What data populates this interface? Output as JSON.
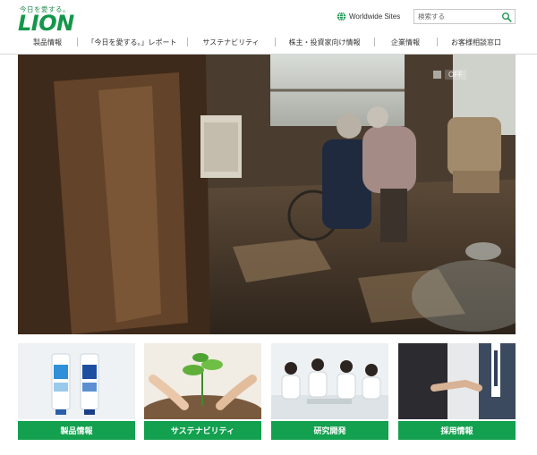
{
  "brand": {
    "tagline": "今日を愛する。",
    "logo_text": "LION",
    "color": "#14974a"
  },
  "header": {
    "worldwide_label": "Worldwide Sites",
    "search_placeholder": "検索する"
  },
  "nav": {
    "items": [
      {
        "label": "製品情報"
      },
      {
        "label": "「今日を愛する。」レポート"
      },
      {
        "label": "サステナビリティ"
      },
      {
        "label": "株主・投資家向け情報"
      },
      {
        "label": "企業情報"
      },
      {
        "label": "お客様相談窓口"
      }
    ]
  },
  "hero": {
    "toggle_off": "OFF"
  },
  "cards": [
    {
      "label": "製品情報",
      "image": "toothpaste-tubes-photo"
    },
    {
      "label": "サステナビリティ",
      "image": "planting-seedling-photo"
    },
    {
      "label": "研究開発",
      "image": "researchers-photo"
    },
    {
      "label": "採用情報",
      "image": "handshake-photo"
    }
  ],
  "colors": {
    "accent_green": "#13a04f",
    "nav_divider": "#bbbbbb"
  }
}
